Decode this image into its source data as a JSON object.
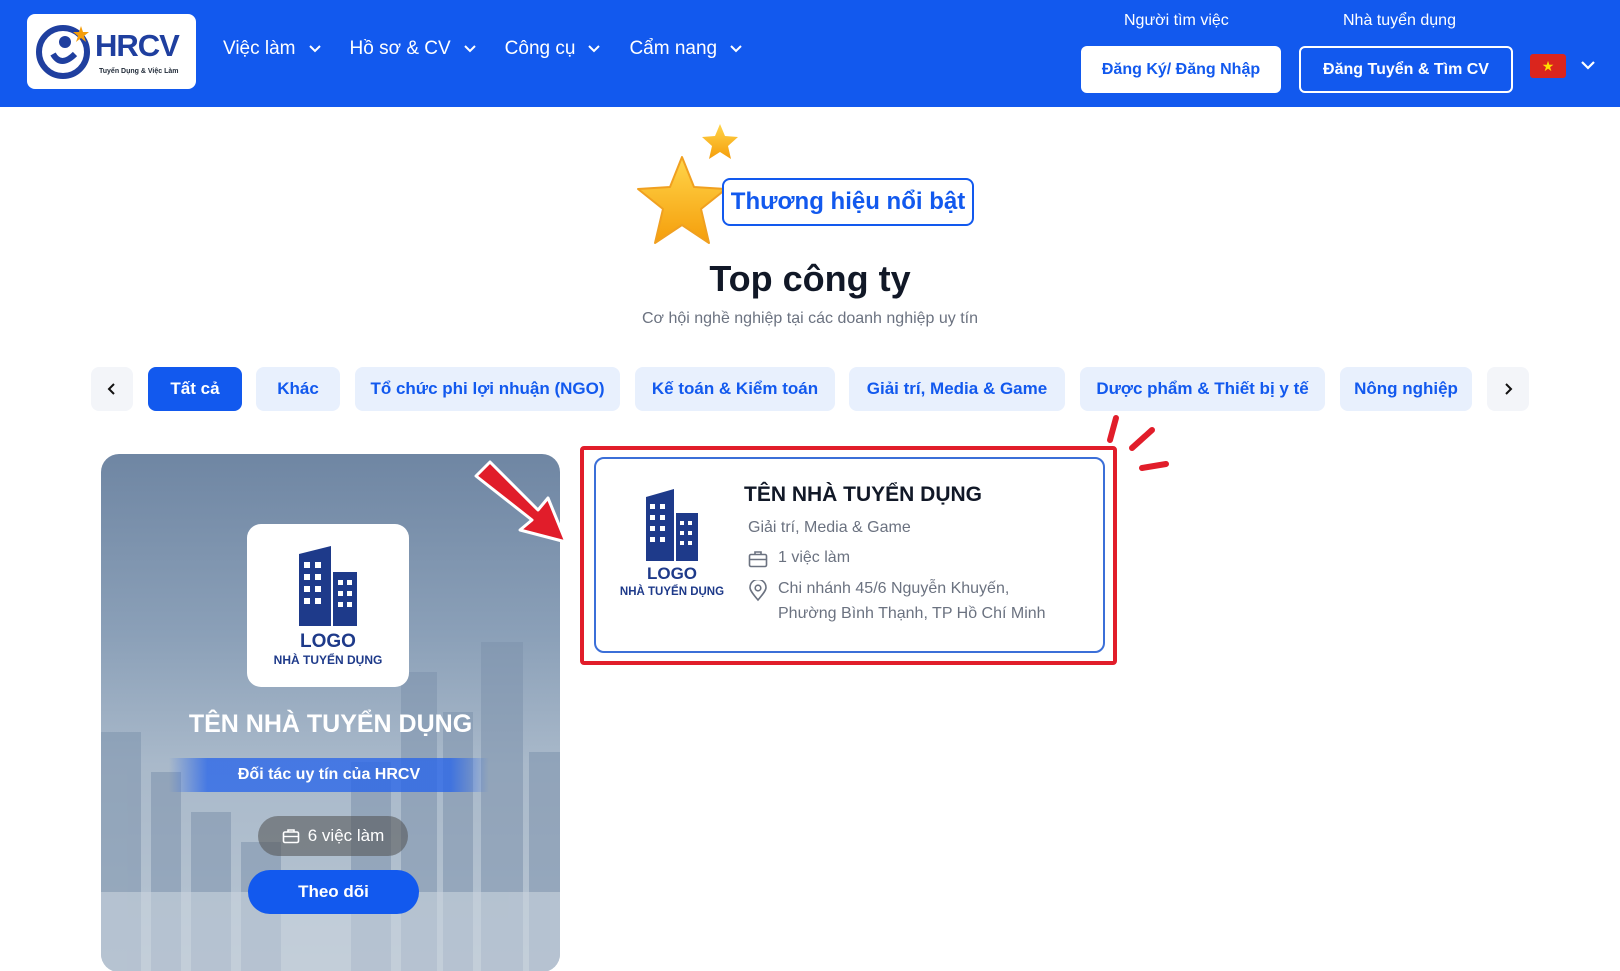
{
  "header": {
    "brand": "HRCV",
    "brand_tagline": "Tuyển Dụng & Việc Làm",
    "nav": [
      {
        "label": "Việc làm"
      },
      {
        "label": "Hồ sơ & CV"
      },
      {
        "label": "Công cụ"
      },
      {
        "label": "Cẩm nang"
      }
    ],
    "job_seeker_label": "Người tìm việc",
    "employer_label": "Nhà tuyển dụng",
    "login_button": "Đăng Ký/ Đăng Nhập",
    "post_button": "Đăng Tuyển & Tìm CV",
    "language_flag": "vietnam-flag-icon"
  },
  "section": {
    "badge": "Thương hiệu nổi bật",
    "title": "Top công ty",
    "subtitle": "Cơ hội nghề nghiệp tại các doanh nghiệp uy tín"
  },
  "tabs": [
    {
      "label": "Tất cả",
      "active": true
    },
    {
      "label": "Khác"
    },
    {
      "label": "Tổ chức phi lợi nhuận (NGO)"
    },
    {
      "label": "Kế toán & Kiểm toán"
    },
    {
      "label": "Giải trí, Media & Game"
    },
    {
      "label": "Dược phẩm & Thiết bị y tế"
    },
    {
      "label": "Nông nghiệp"
    }
  ],
  "featured": {
    "logo_line1": "LOGO",
    "logo_line2": "NHÀ TUYỂN DỤNG",
    "name": "TÊN NHÀ TUYỂN DỤNG",
    "partner_label": "Đối tác uy tín của HRCV",
    "jobs": "6 việc làm",
    "follow_button": "Theo dõi"
  },
  "employer_card": {
    "logo_line1": "LOGO",
    "logo_line2": "NHÀ TUYỂN DỤNG",
    "name": "TÊN NHÀ TUYỂN DỤNG",
    "industry": "Giải trí, Media & Game",
    "jobs": "1 việc làm",
    "address_line1": "Chi nhánh 45/6 Nguyễn Khuyến,",
    "address_line2": "Phường Bình Thạnh, TP Hồ Chí Minh"
  },
  "colors": {
    "primary": "#1259ee",
    "highlight": "#e11d2a",
    "logo_navy": "#1e3a8a"
  }
}
